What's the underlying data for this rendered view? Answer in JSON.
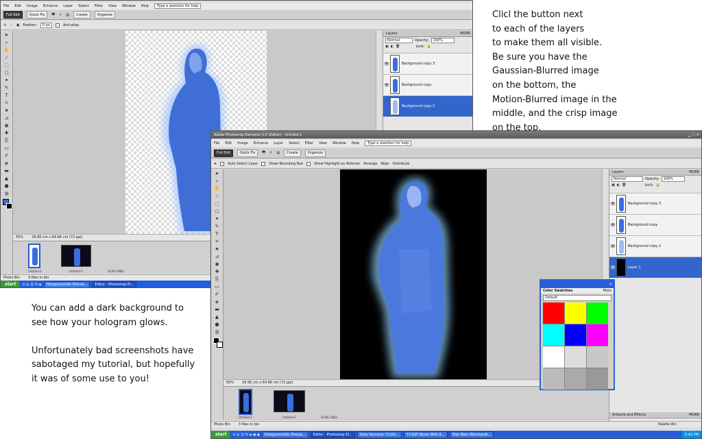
{
  "back_window": {
    "menu": [
      "File",
      "Edit",
      "Image",
      "Enhance",
      "Layer",
      "Select",
      "Filter",
      "View",
      "Window",
      "Help"
    ],
    "help_placeholder": "Type a question for help",
    "modes": {
      "full_edit": "Full Edit",
      "quick_fix": "Quick Fix",
      "create": "Create",
      "organize": "Organize"
    },
    "options": {
      "feather_label": "Feather:",
      "feather_value": "0 px",
      "antialias": "Anti-alias"
    },
    "zoom": "50%",
    "doc_size": "29.95 cm x 64.66 cm (72 ppi)",
    "bin": {
      "label": "Photo Bin",
      "count": "3 files in bin",
      "thumbs": [
        "Untitled-1",
        "Untitled-2",
        "SCAN LINES"
      ]
    },
    "layers_panel": {
      "title": "Layers",
      "more": "MORE",
      "blend": "Normal",
      "opacity_label": "Opacity:",
      "opacity": "100%",
      "lock_label": "Lock:",
      "layers": [
        "Background copy 3",
        "Background copy",
        "Background copy 2"
      ]
    },
    "taskbar": {
      "start": "start",
      "items": [
        "Hologramstille (Previe...",
        "Editor - Photoshop El..."
      ]
    }
  },
  "front_window": {
    "title": "Adobe Photoshop Elements 5.0 (Editor) - Untitled-1",
    "menu": [
      "File",
      "Edit",
      "Image",
      "Enhance",
      "Layer",
      "Select",
      "Filter",
      "View",
      "Window",
      "Help"
    ],
    "help_placeholder": "Type a question for help",
    "modes": {
      "full_edit": "Full Edit",
      "quick_fix": "Quick Fix",
      "create": "Create",
      "organize": "Organize"
    },
    "options": {
      "auto_select": "Auto Select Layer",
      "bounding": "Show Bounding Box",
      "highlight": "Show Highlight on Rollover",
      "arrange": "Arrange",
      "align": "Align",
      "distribute": "Distribute"
    },
    "zoom": "50%",
    "doc_size": "29.95 cm x 64.66 cm (72 ppi)",
    "bin": {
      "label": "Photo Bin",
      "count": "3 files in bin",
      "thumbs": [
        "Untitled-1",
        "Untitled-2",
        "SCAN LINES"
      ]
    },
    "layers_panel": {
      "title": "Layers",
      "more": "MORE",
      "blend": "Normal",
      "opacity_label": "Opacity:",
      "opacity": "100%",
      "lock_label": "Lock:",
      "layers": [
        "Background copy 3",
        "Background copy",
        "Background copy 2",
        "Layer 1"
      ]
    },
    "artwork_panel": {
      "title": "Artwork and Effects",
      "more": "MORE"
    },
    "palette_bin": "Palette Bin",
    "swatches": {
      "title": "Color Swatches",
      "more": "More",
      "preset": "Default",
      "colors": [
        "#ff0000",
        "#ffff00",
        "#00ff00",
        "#00ffff",
        "#0000ff",
        "#ff00ff",
        "#ffffff",
        "#dddddd",
        "#c8c8c8",
        "#bbbbbb",
        "#aaaaaa",
        "#999999"
      ]
    },
    "taskbar": {
      "start": "start",
      "items": [
        "Hologramstille (Previe...",
        "Editor - Photoshop El...",
        "Data Services: Y-CAS...",
        "Y-CAST Music With R...",
        "Star Wars Merchandi..."
      ],
      "time": "5:42 PM"
    }
  },
  "notes": {
    "right": [
      "Clicl the button next",
      "to each of the layers",
      "to make them all visible.",
      "Be sure you have the",
      "Gaussian-Blurred image",
      "on the bottom, the",
      "Motion-Blurred image in the",
      "middle, and the crisp image",
      "on the top."
    ],
    "left": [
      "You can add a dark background to",
      "see how your hologram glows.",
      "",
      "Unfortunately bad screenshots have",
      "sabotaged my tutorial, but hopefully",
      "it was of some use to you!"
    ]
  }
}
